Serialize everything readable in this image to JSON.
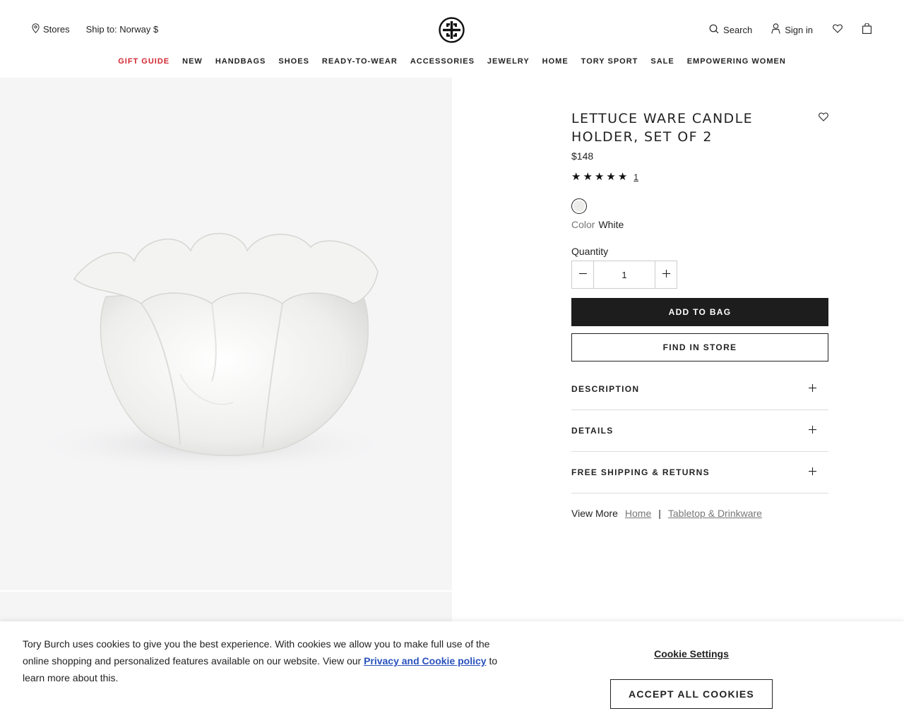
{
  "header": {
    "stores_label": "Stores",
    "ship_label": "Ship to: Norway $",
    "search_label": "Search",
    "signin_label": "Sign in"
  },
  "nav": {
    "items": [
      "GIFT GUIDE",
      "NEW",
      "HANDBAGS",
      "SHOES",
      "READY-TO-WEAR",
      "ACCESSORIES",
      "JEWELRY",
      "HOME",
      "TORY SPORT",
      "SALE",
      "EMPOWERING WOMEN"
    ],
    "accent_color": "#d22630"
  },
  "product": {
    "title": "LETTUCE WARE CANDLE HOLDER, SET OF 2",
    "price": "$148",
    "rating_stars": 5,
    "rating_count": "1",
    "color_label": "Color",
    "color_value": "White",
    "quantity_label": "Quantity",
    "quantity_value": "1",
    "add_to_bag": "ADD TO BAG",
    "find_in_store": "FIND IN STORE",
    "accordions": [
      "DESCRIPTION",
      "DETAILS",
      "FREE SHIPPING & RETURNS"
    ],
    "view_more_label": "View More",
    "view_more_links": [
      "Home",
      "Tabletop & Drinkware"
    ]
  },
  "cookie": {
    "text_before": "Tory Burch uses cookies to give you the best experience. With cookies we allow you to make full use of the online shopping and personalized features available on our website. View our ",
    "link": "Privacy and Cookie policy",
    "text_after": " to learn more about this.",
    "settings_label": "Cookie Settings",
    "accept_label": "ACCEPT ALL COOKIES"
  },
  "icons": {
    "location": "map-pin-icon",
    "search": "search-icon",
    "user": "user-icon",
    "heart": "heart-icon",
    "bag": "shopping-bag-icon",
    "logo": "tory-burch-logo",
    "star": "star-icon"
  },
  "colors": {
    "gallery_bg": "#f5f5f6",
    "primary_button": "#1d1d1d",
    "link_blue": "#2a52be"
  }
}
